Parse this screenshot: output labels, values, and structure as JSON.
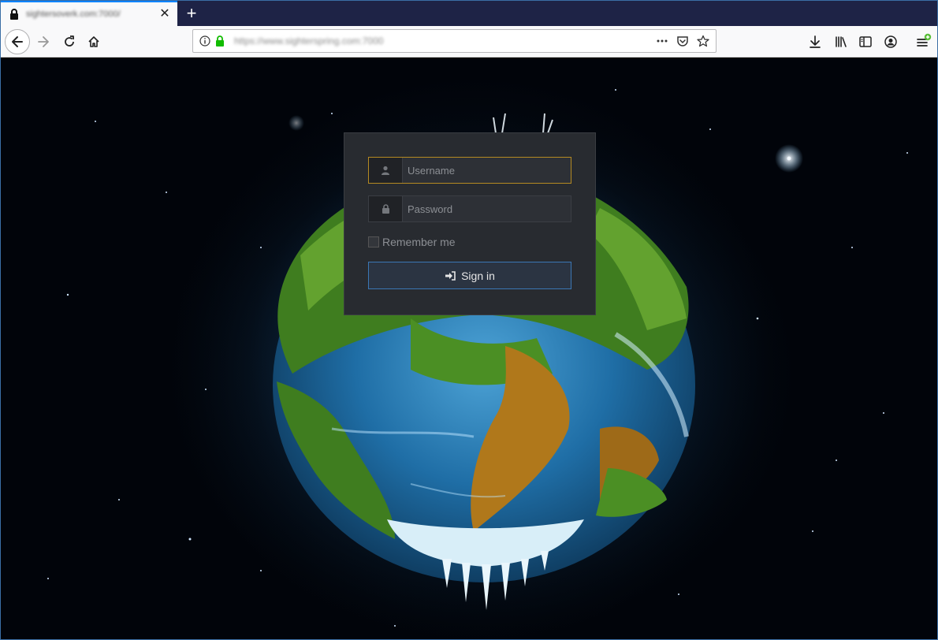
{
  "browser": {
    "tab_title": "sightersoverk.com:7000/",
    "close_tab_glyph": "✕",
    "new_tab_glyph": "+",
    "url": "https://www.sighterspring.com:7000",
    "icons": {
      "lock": "lock-icon",
      "back": "back-arrow-icon",
      "forward": "forward-arrow-icon",
      "reload": "reload-icon",
      "home": "home-icon",
      "info": "info-icon",
      "secure": "secure-lock-icon",
      "page_actions": "more-dots-icon",
      "pocket": "pocket-icon",
      "bookmark": "star-icon",
      "downloads": "download-icon",
      "library": "library-icon",
      "sidebar": "sidebar-icon",
      "account": "account-icon",
      "menu": "hamburger-menu-icon"
    },
    "colors": {
      "accent": "#0a84ff",
      "tabstrip": "#1e2346",
      "secure": "#12bc00",
      "update_badge": "#57bd35"
    }
  },
  "login": {
    "username_placeholder": "Username",
    "password_placeholder": "Password",
    "remember_label": "Remember me",
    "remember_checked": false,
    "signin_label": "Sign in",
    "colors": {
      "panel": "#282b30",
      "focus_border": "#b58a22",
      "button_border": "#3b77b5"
    }
  }
}
